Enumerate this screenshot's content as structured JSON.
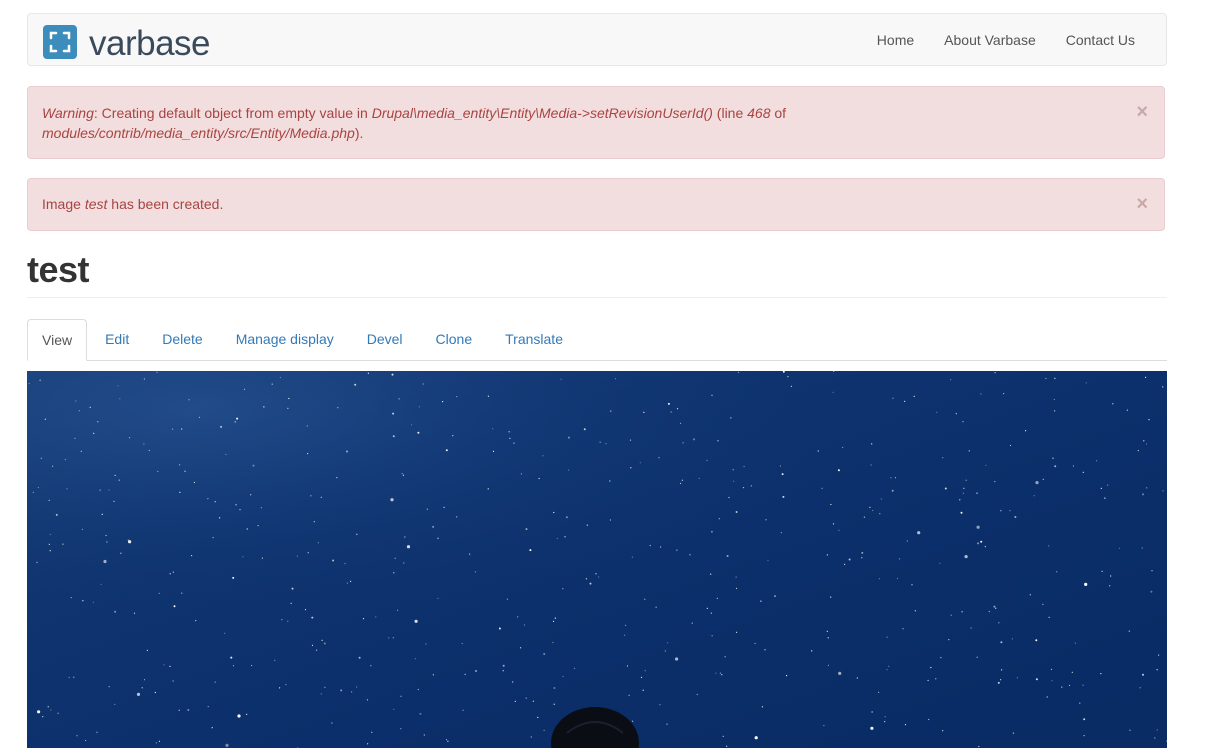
{
  "brand": {
    "name_bold": "var",
    "name_light": "base",
    "logo_color": "#3c8dbc"
  },
  "nav": {
    "items": [
      "Home",
      "About Varbase",
      "Contact Us"
    ]
  },
  "alerts": {
    "warning": {
      "label": "Warning",
      "text1": ": Creating default object from empty value in ",
      "code1": "Drupal\\media_entity\\Entity\\Media->setRevisionUserId()",
      "text2": " (line ",
      "line": "468",
      "text3": " of ",
      "code2": "modules/contrib/media_entity/src/Entity/Media.php",
      "text4": ").",
      "close": "×"
    },
    "status": {
      "prefix": "Image ",
      "name": "test",
      "suffix": " has been created.",
      "close": "×"
    }
  },
  "page": {
    "title": "test"
  },
  "tabs": [
    "View",
    "Edit",
    "Delete",
    "Manage display",
    "Devel",
    "Clone",
    "Translate"
  ],
  "colors": {
    "alert_bg": "#f2dede",
    "alert_text": "#a94442",
    "link": "#337ab7",
    "night_sky": "#0b2f6a"
  }
}
